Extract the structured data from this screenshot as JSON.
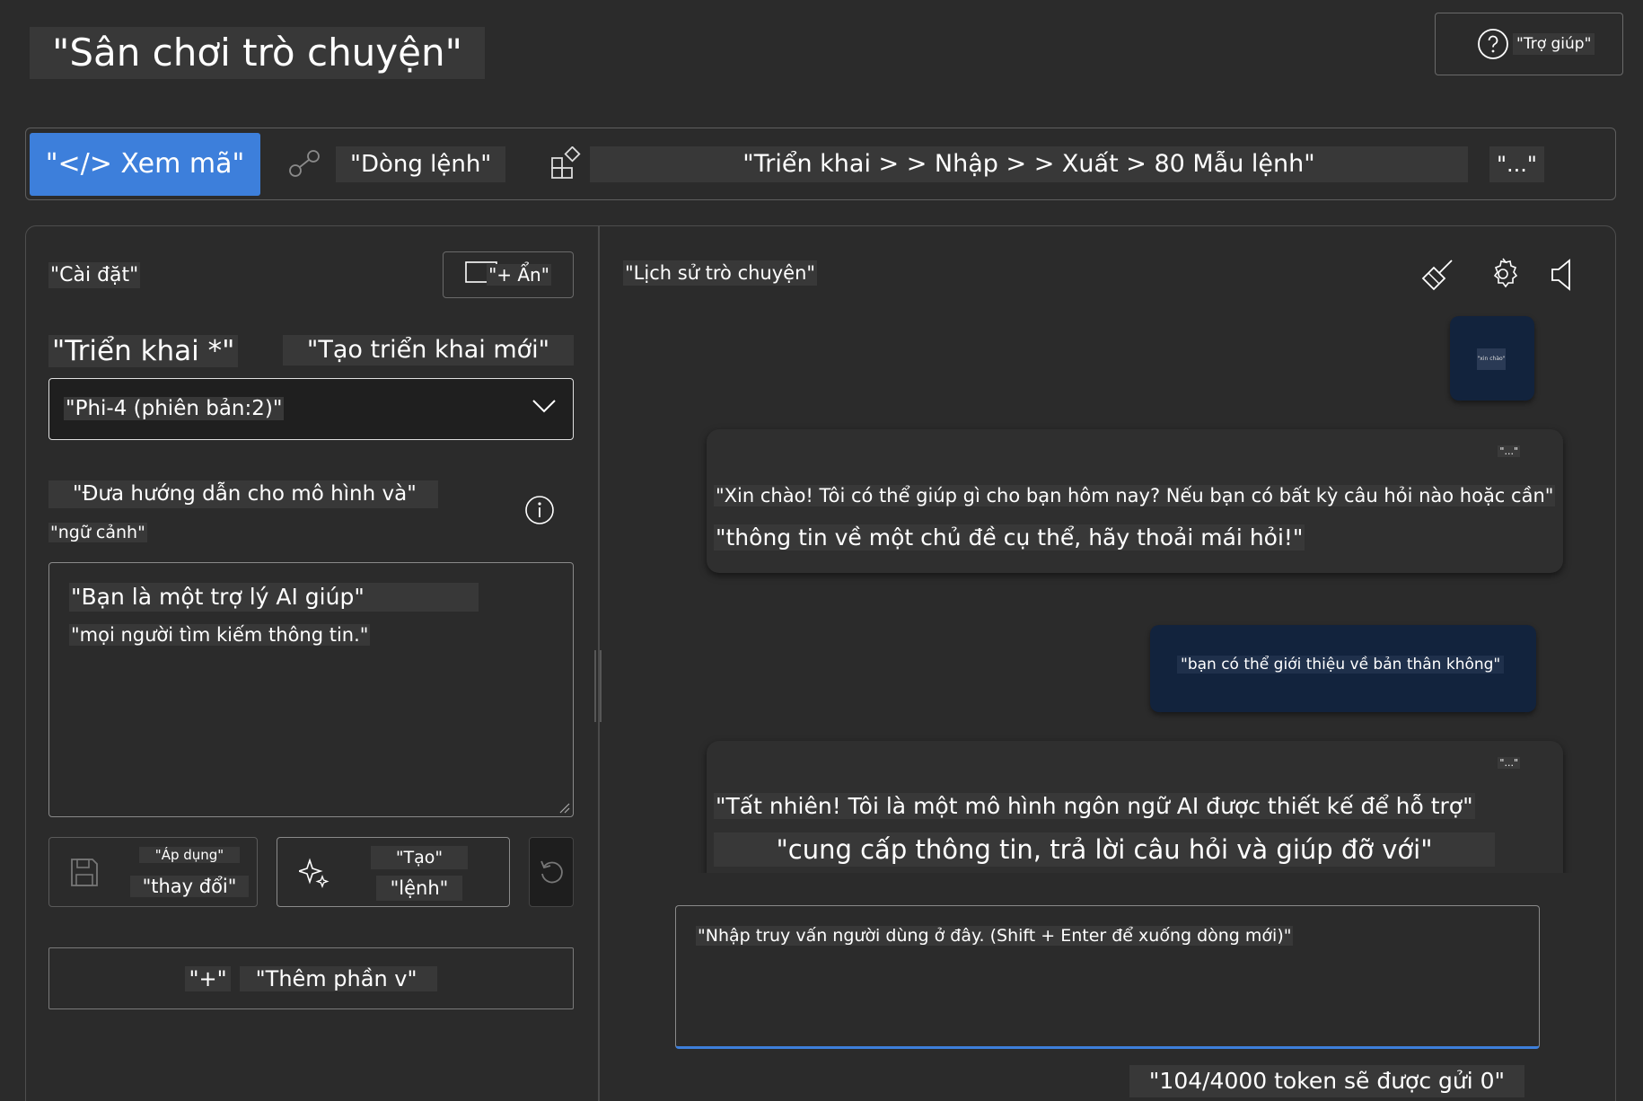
{
  "header": {
    "title": "\"Sân chơi trò chuyện\"",
    "help_label": "\"Trợ giúp\""
  },
  "toolbar": {
    "view_code_label": "\"</> Xem mã\"",
    "command_label": "\"Dòng lệnh\"",
    "breadcrumb": "\"Triển khai > > Nhập > > Xuất > 80 Mẫu lệnh\"",
    "more_label": "\"...\""
  },
  "settings": {
    "title": "\"Cài đặt\"",
    "hide_label": "\"+ Ẩn\"",
    "deployment_label": "\"Triển khai *\"",
    "new_deployment_label": "\"Tạo triển khai mới\"",
    "deployment_value": "\"Phi-4 (phiên bản:2)\"",
    "instructions_label_line1": "\"Đưa hướng dẫn cho mô hình và\"",
    "instructions_label_line2": "\"ngữ cảnh\"",
    "system_message_line1": "\"Bạn là một trợ lý AI giúp\"",
    "system_message_line2": "\"mọi người tìm kiếm thông tin.\"",
    "apply_line1": "\"Áp dụng\"",
    "apply_line2": "\"thay đổi\"",
    "generate_line1": "\"Tạo\"",
    "generate_line2": "\"lệnh\"",
    "add_section_plus": "\"+\"",
    "add_section_label": "\"Thêm phần v\""
  },
  "chat": {
    "title": "\"Lịch sử trò chuyện\"",
    "messages": [
      {
        "role": "user",
        "text": "\"xin chào\""
      },
      {
        "role": "assistant",
        "menu": "\"...\"",
        "line1": "\"Xin chào! Tôi có thể giúp gì cho bạn hôm nay? Nếu bạn có bất kỳ câu hỏi nào hoặc cần\"",
        "line2": "\"thông tin về một chủ đề cụ thể, hãy thoải mái hỏi!\""
      },
      {
        "role": "user",
        "text": "\"bạn có thể giới thiệu về bản thân không\""
      },
      {
        "role": "assistant",
        "menu": "\"...\"",
        "line1": "\"Tất nhiên! Tôi là một mô hình ngôn ngữ AI được thiết kế để hỗ trợ\"",
        "line2": "\"cung cấp thông tin, trả lời câu hỏi và giúp đỡ với\""
      }
    ],
    "input_placeholder": "\"Nhập truy vấn người dùng ở đây. (Shift + Enter để xuống dòng mới)\"",
    "token_count": "\"104/4000 token sẽ được gửi 0\""
  },
  "icons": {
    "help": "question-circle-icon",
    "command": "link-icon",
    "apps": "apps-grid-icon",
    "hide": "panel-icon",
    "dropdown": "chevron-down-icon",
    "info": "info-icon",
    "save": "save-icon",
    "generate": "sparkle-icon",
    "undo": "undo-icon",
    "clear": "broom-icon",
    "settings": "gear-icon",
    "audio": "speaker-icon"
  },
  "colors": {
    "background": "#2b2b2b",
    "accent": "#3d7fdb",
    "user_bubble": "#12233d",
    "assistant_bubble": "#2f2f2f",
    "text_highlight": "#383838"
  }
}
